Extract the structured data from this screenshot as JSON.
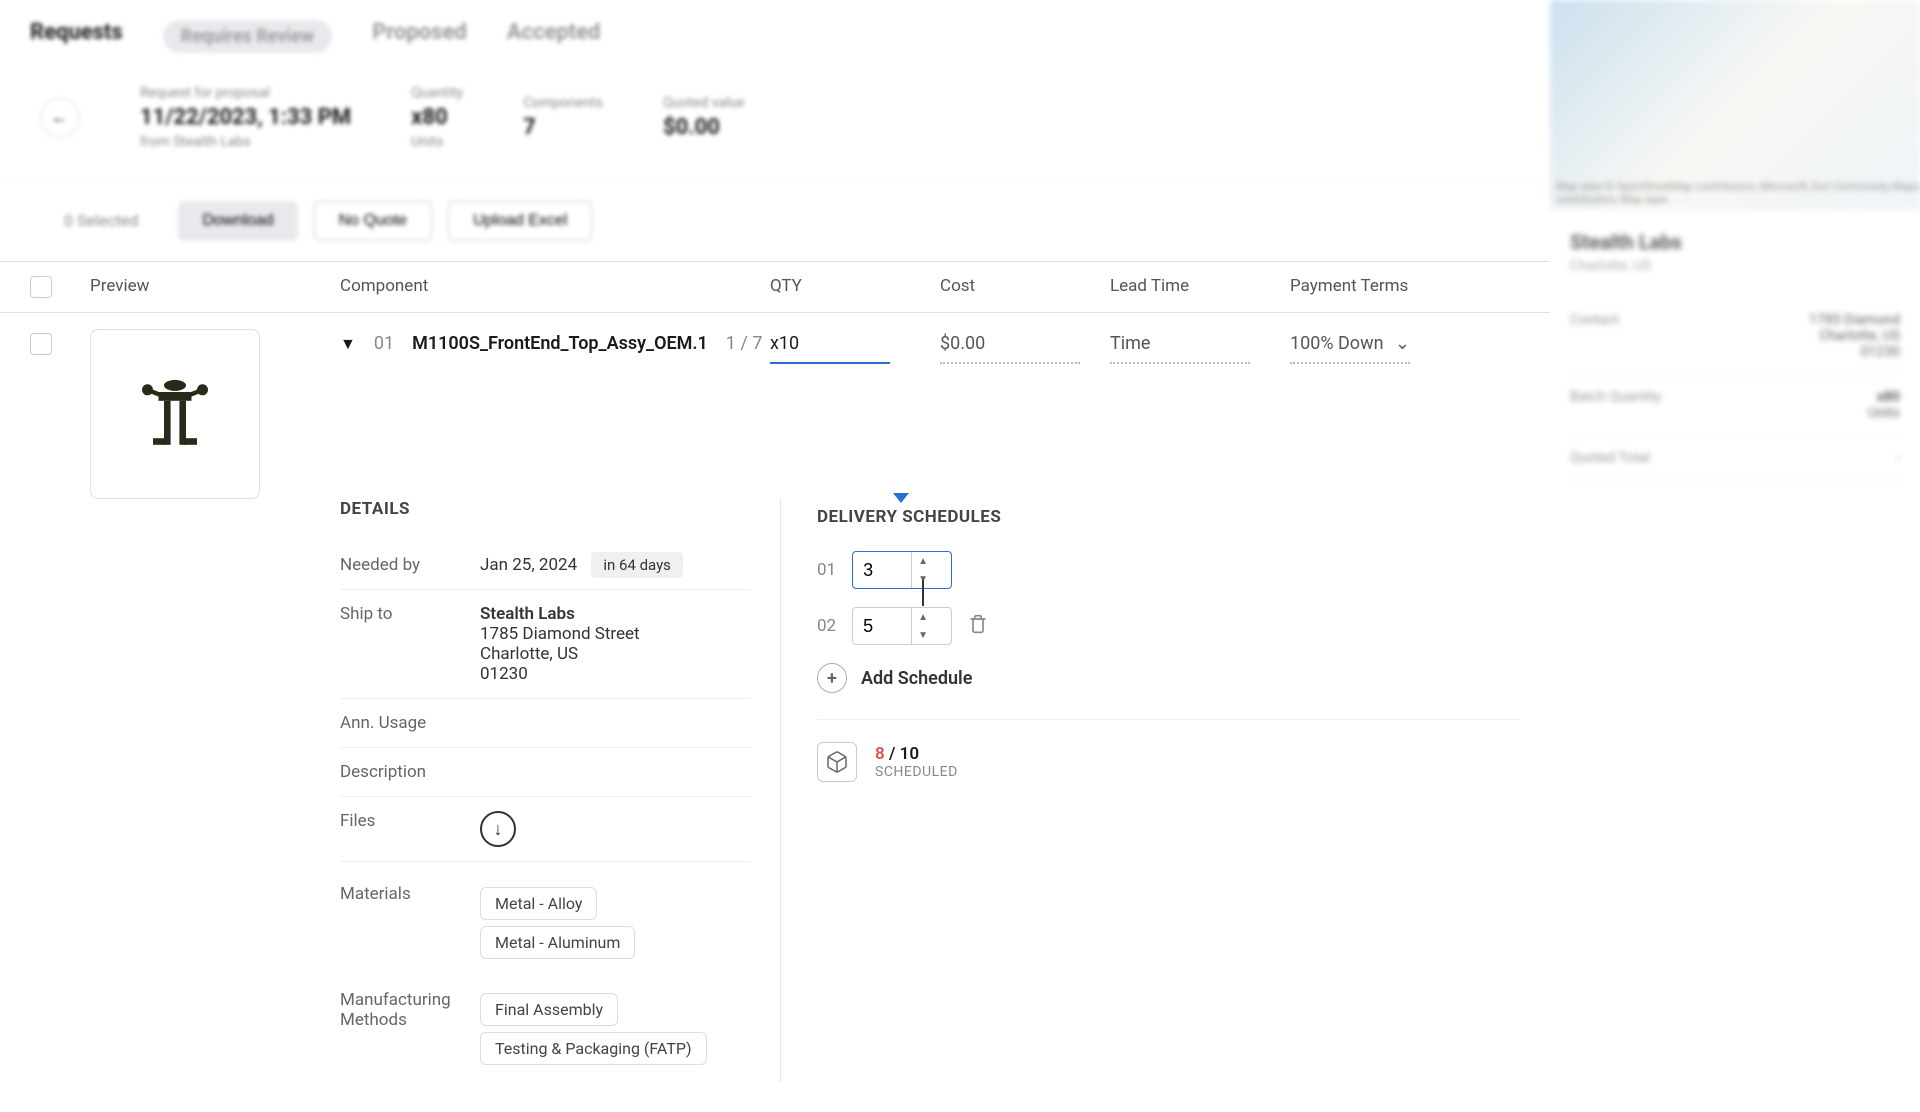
{
  "tabs": [
    "Requests",
    "Requires Review",
    "Proposed",
    "Accepted"
  ],
  "active_tab": 0,
  "summary": {
    "rfp_label": "Request for proposal",
    "rfp_value": "11/22/2023, 1:33 PM",
    "rfp_from": "from Stealth Labs",
    "qty_label": "Quantity",
    "qty_value": "x80",
    "qty_sub": "Units",
    "comp_label": "Components",
    "comp_value": "7",
    "quoted_label": "Quoted value",
    "quoted_value": "$0.00"
  },
  "actions": {
    "selected": "0 Selected",
    "download": "Download",
    "noquote": "No Quote",
    "upload": "Upload Excel"
  },
  "columns": [
    "Preview",
    "Component",
    "QTY",
    "Cost",
    "Lead Time",
    "Payment Terms"
  ],
  "row": {
    "index": "01",
    "name": "M1100S_FrontEnd_Top_Assy_OEM.1",
    "count": "1 / 7",
    "qty": "x10",
    "cost": "$0.00",
    "lead": "Time",
    "payment": "100% Down"
  },
  "details": {
    "title": "DETAILS",
    "needed_label": "Needed by",
    "needed_value": "Jan 25, 2024",
    "needed_badge": "in 64 days",
    "ship_label": "Ship to",
    "ship_name": "Stealth Labs",
    "ship_addr1": "1785 Diamond Street",
    "ship_addr2": "Charlotte, US",
    "ship_addr3": "01230",
    "usage_label": "Ann. Usage",
    "desc_label": "Description",
    "files_label": "Files",
    "materials_label": "Materials",
    "materials": [
      "Metal - Alloy",
      "Metal - Aluminum"
    ],
    "methods_label": "Manufacturing Methods",
    "methods": [
      "Final Assembly",
      "Testing & Packaging (FATP)"
    ]
  },
  "schedules": {
    "title": "DELIVERY SCHEDULES",
    "rows": [
      {
        "num": "01",
        "val": "3",
        "focused": true,
        "deletable": false
      },
      {
        "num": "02",
        "val": "5",
        "focused": false,
        "deletable": true
      }
    ],
    "add_label": "Add Schedule",
    "summary_current": "8",
    "summary_total": " / 10",
    "summary_label": "SCHEDULED"
  },
  "sidebar": {
    "company": "Stealth Labs",
    "location": "Charlotte, US",
    "contact_label": "Contact",
    "contact_addr1": "1785 Diamond",
    "contact_addr2": "Charlotte, US",
    "contact_addr3": "01230",
    "batch_label": "Batch Quantity",
    "batch_value": "x80",
    "batch_sub": "Units",
    "total_label": "Quoted Total",
    "total_value": "-",
    "map_attr": "Map data © OpenStreetMap contributors, Microsoft, Esri Community Maps contributors, Map layer"
  }
}
